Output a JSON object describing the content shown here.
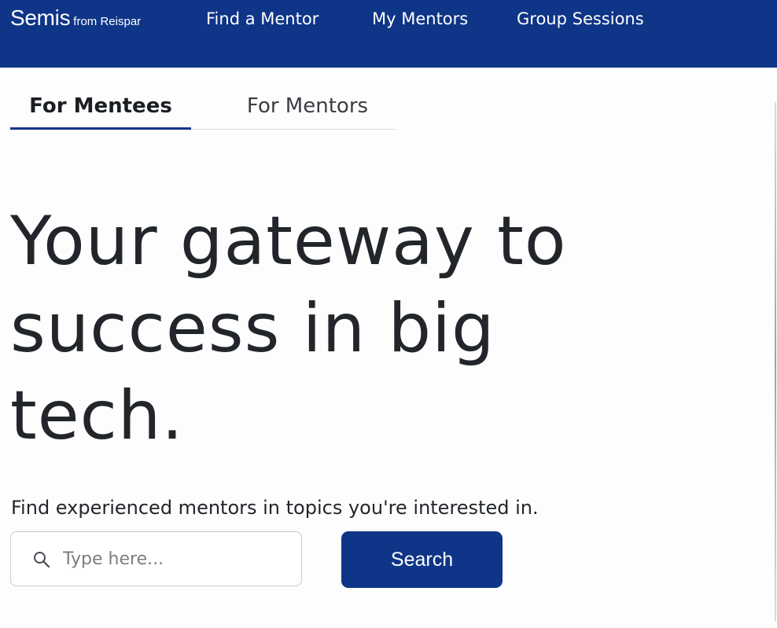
{
  "brand": {
    "name": "Semis",
    "sub": "from Reispar"
  },
  "nav": {
    "items": [
      {
        "label": "Find a Mentor"
      },
      {
        "label": "My Mentors"
      },
      {
        "label": "Group Sessions"
      }
    ]
  },
  "tabs": [
    {
      "label": "For Mentees",
      "active": true
    },
    {
      "label": "For Mentors",
      "active": false
    }
  ],
  "hero": {
    "title": "Your gateway to success in big tech."
  },
  "search": {
    "subtitle": "Find experienced mentors in topics you're interested in.",
    "placeholder": "Type here...",
    "value": "",
    "button_label": "Search"
  },
  "colors": {
    "primary": "#0e3587",
    "text": "#22262b",
    "background": "#fdfdfd"
  }
}
